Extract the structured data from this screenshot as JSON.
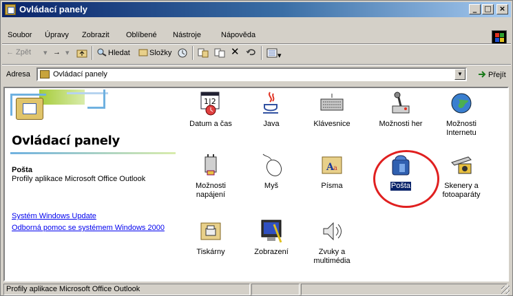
{
  "window": {
    "title": "Ovládací panely"
  },
  "titlebar_buttons": {
    "minimize": "_",
    "maximize": "□",
    "close": "×"
  },
  "menu": {
    "items": [
      "Soubor",
      "Úpravy",
      "Zobrazit",
      "Oblíbené",
      "Nástroje",
      "Nápověda"
    ]
  },
  "toolbar": {
    "back": "← Zpět",
    "forward": "→",
    "search": "Hledat",
    "folders": "Složky"
  },
  "address": {
    "label": "Adresa",
    "value": "Ovládací panely",
    "go": "Přejít"
  },
  "left_pane": {
    "title": "Ovládací panely",
    "selected_name": "Pošta",
    "selected_desc": "Profily aplikace Microsoft Office Outlook",
    "links": [
      "Systém Windows Update",
      "Odborná pomoc se systémem Windows 2000"
    ]
  },
  "items": [
    {
      "label": "Datum a čas",
      "icon": "calendar-clock-icon"
    },
    {
      "label": "Java",
      "icon": "java-cup-icon"
    },
    {
      "label": "Klávesnice",
      "icon": "keyboard-icon"
    },
    {
      "label": "Možnosti her",
      "icon": "joystick-icon"
    },
    {
      "label": "Možnosti Internetu",
      "icon": "globe-icon"
    },
    {
      "label": "Možnosti napájení",
      "icon": "power-plug-icon"
    },
    {
      "label": "Myš",
      "icon": "mouse-icon"
    },
    {
      "label": "Písma",
      "icon": "fonts-folder-icon"
    },
    {
      "label": "Pošta",
      "icon": "mail-icon"
    },
    {
      "label": "Skenery a fotoaparáty",
      "icon": "scanner-camera-icon"
    },
    {
      "label": "Tiskárny",
      "icon": "printer-folder-icon"
    },
    {
      "label": "Zobrazení",
      "icon": "display-icon"
    },
    {
      "label": "Zvuky a multimédia",
      "icon": "speaker-icon"
    }
  ],
  "status": {
    "text": "Profily aplikace Microsoft Office Outlook"
  },
  "colors": {
    "titlebar": "#0a246a",
    "selection": "#0a246a",
    "highlight_circle": "#e02020",
    "link": "#0000ee"
  }
}
